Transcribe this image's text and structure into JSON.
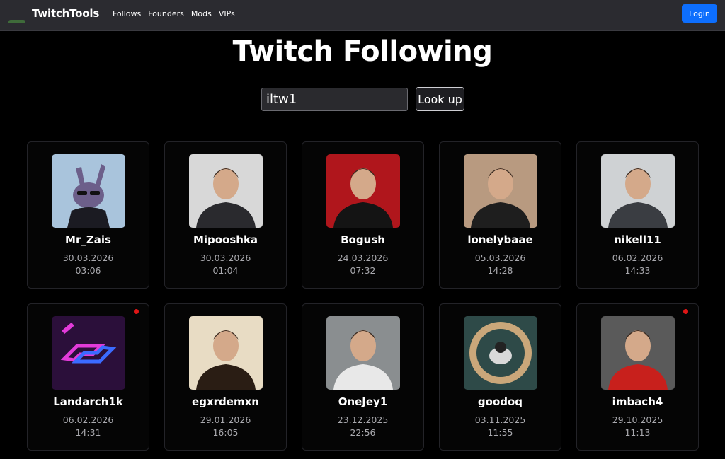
{
  "nav": {
    "brand": "TwitchTools",
    "links": [
      "Follows",
      "Founders",
      "Mods",
      "VIPs"
    ],
    "login_label": "Login"
  },
  "page": {
    "title": "Twitch Following"
  },
  "search": {
    "value": "iltw1",
    "button_label": "Look up"
  },
  "follows": [
    {
      "name": "Mr_Zais",
      "date": "30.03.2026",
      "time": "03:06",
      "live": false,
      "avatar": "cartoon-rabbit-avatar",
      "colors": [
        "#a9c4dc",
        "#6c5f8a"
      ]
    },
    {
      "name": "Mipooshka",
      "date": "30.03.2026",
      "time": "01:04",
      "live": false,
      "avatar": "portrait-avatar",
      "colors": [
        "#d8d8d8",
        "#2a2a2e"
      ]
    },
    {
      "name": "Bogush",
      "date": "24.03.2026",
      "time": "07:32",
      "live": false,
      "avatar": "portrait-avatar",
      "colors": [
        "#b0161c",
        "#141414"
      ]
    },
    {
      "name": "lonelybaae",
      "date": "05.03.2026",
      "time": "14:28",
      "live": false,
      "avatar": "portrait-avatar",
      "colors": [
        "#b89a80",
        "#1e1e1e"
      ]
    },
    {
      "name": "nikell11",
      "date": "06.02.2026",
      "time": "14:33",
      "live": false,
      "avatar": "portrait-avatar",
      "colors": [
        "#cfd2d4",
        "#3a3d42"
      ]
    },
    {
      "name": "Landarch1k",
      "date": "06.02.2026",
      "time": "14:31",
      "live": true,
      "avatar": "neon-logo-avatar",
      "colors": [
        "#2b0f3a",
        "#e23bd9"
      ]
    },
    {
      "name": "egxrdemxn",
      "date": "29.01.2026",
      "time": "16:05",
      "live": false,
      "avatar": "portrait-avatar",
      "colors": [
        "#e8dcc4",
        "#2a1d14"
      ]
    },
    {
      "name": "OneJey1",
      "date": "23.12.2025",
      "time": "22:56",
      "live": false,
      "avatar": "portrait-avatar",
      "colors": [
        "#8a8e90",
        "#e8e8e8"
      ]
    },
    {
      "name": "goodoq",
      "date": "03.11.2025",
      "time": "11:55",
      "live": false,
      "avatar": "round-badge-avatar",
      "colors": [
        "#2e4a48",
        "#caa77a"
      ]
    },
    {
      "name": "imbach4",
      "date": "29.10.2025",
      "time": "11:13",
      "live": true,
      "avatar": "portrait-avatar",
      "colors": [
        "#5a5a5a",
        "#c8201c"
      ]
    }
  ]
}
